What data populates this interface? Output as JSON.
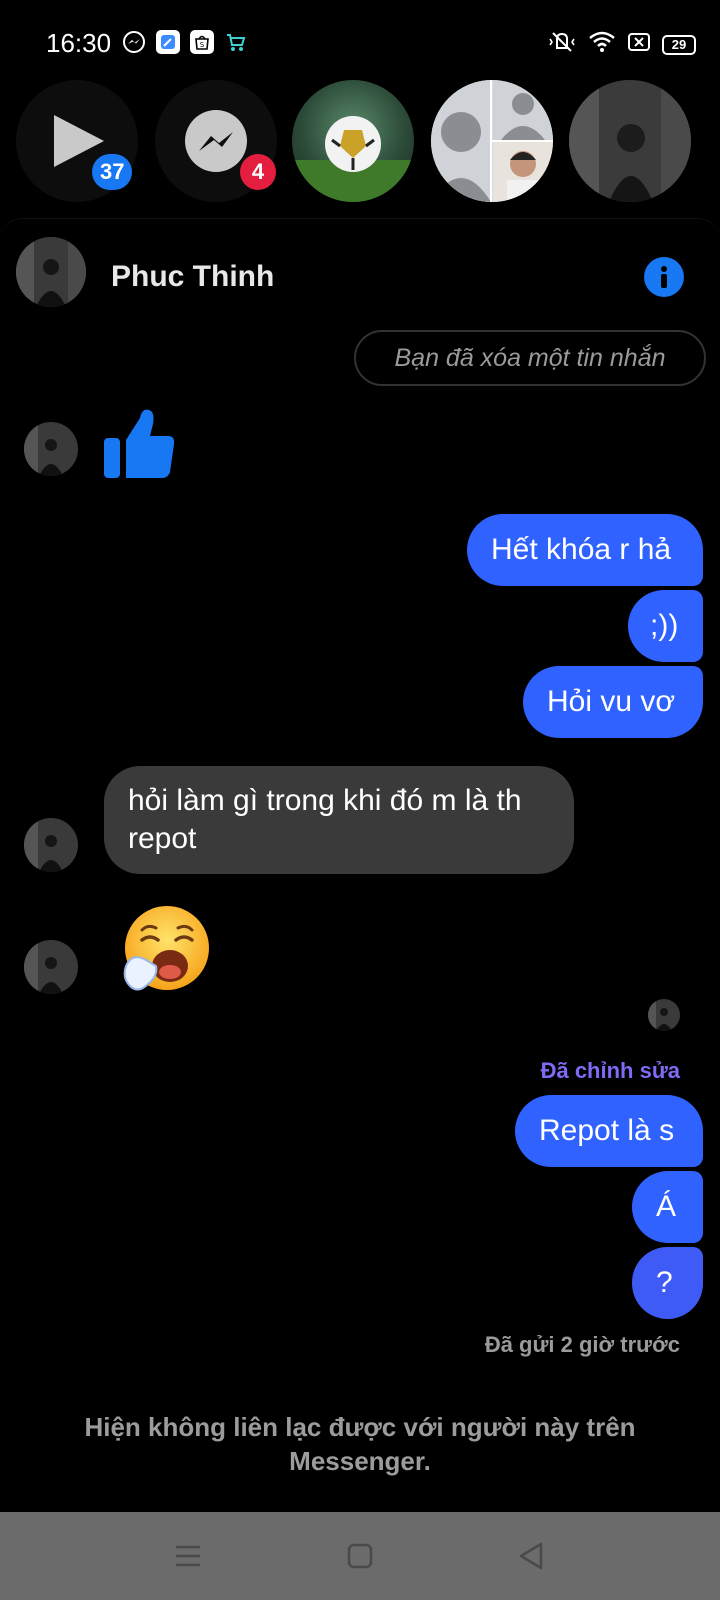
{
  "status_bar": {
    "time": "16:30",
    "app_icons": [
      "messenger-icon",
      "notes-app-icon",
      "shopee-icon",
      "shopping-cart-app-icon"
    ],
    "right_icons": [
      "vibrate-silent-icon",
      "wifi-icon",
      "close-box-icon"
    ],
    "battery": "29"
  },
  "chat_heads": [
    {
      "name": "video-play-head",
      "badge": "37",
      "badge_color": "#1877f2"
    },
    {
      "name": "messenger-head",
      "badge": "4",
      "badge_color": "#e41e3f"
    },
    {
      "name": "football-avatar-head",
      "badge": null
    },
    {
      "name": "group-avatar-head",
      "badge": null
    },
    {
      "name": "photo-avatar-head",
      "badge": null
    }
  ],
  "conversation": {
    "contact_name": "Phuc Thinh",
    "deleted_notice": "Bạn đã xóa một tin nhắn",
    "messages": [
      {
        "from": "me",
        "text": "Hết khóa r hả"
      },
      {
        "from": "me",
        "text": ";))"
      },
      {
        "from": "me",
        "text": "Hỏi vu vơ"
      },
      {
        "from": "them",
        "text": "hỏi làm gì trong khi đó m là th repot"
      },
      {
        "from": "me",
        "text": "Repot là s"
      },
      {
        "from": "me",
        "text": "Á"
      },
      {
        "from": "me",
        "text": "?"
      }
    ],
    "edited_label": "Đã chỉnh sửa",
    "sent_status": "Đã gửi 2 giờ trước",
    "unreachable_notice": "Hiện không liên lạc được với người này trên Messenger."
  },
  "colors": {
    "outgoing_bubble": "#2f62ff",
    "incoming_bubble": "#3a3a3a",
    "accent": "#1877f2",
    "edited_label": "#7d6bf5"
  },
  "nav_bar": {
    "icons": [
      "menu-icon",
      "home-icon",
      "back-icon"
    ]
  }
}
